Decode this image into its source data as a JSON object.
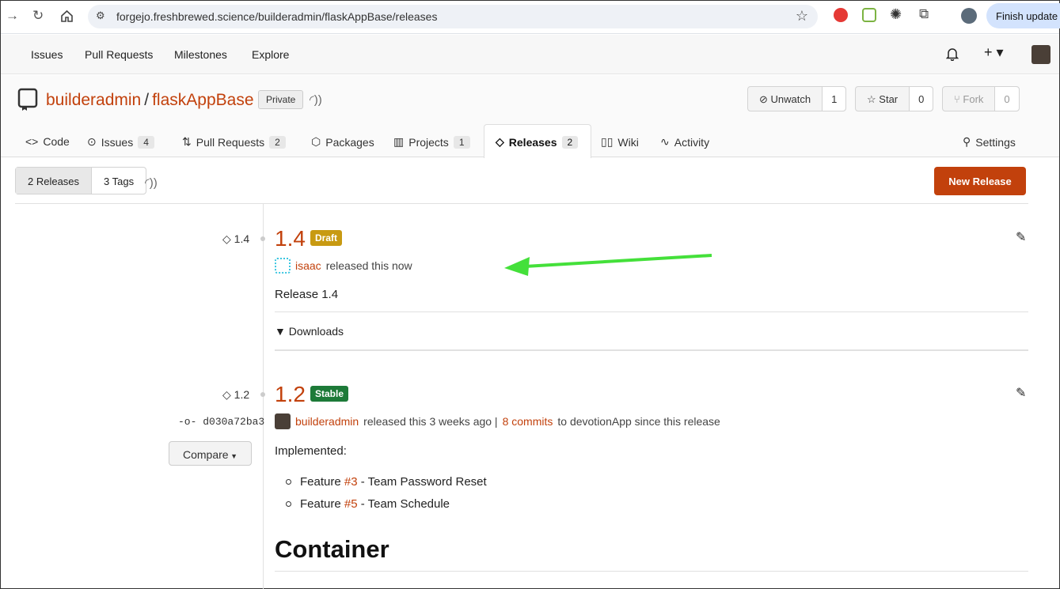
{
  "browser": {
    "url": "forgejo.freshbrewed.science/builderadmin/flaskAppBase/releases",
    "finish_update": "Finish update"
  },
  "topnav": {
    "issues": "Issues",
    "pull_requests": "Pull Requests",
    "milestones": "Milestones",
    "explore": "Explore"
  },
  "repo": {
    "owner": "builderadmin",
    "sep": "/",
    "name": "flaskAppBase",
    "visibility": "Private",
    "unwatch": {
      "label": "Unwatch",
      "count": "1"
    },
    "star": {
      "label": "Star",
      "count": "0"
    },
    "fork": {
      "label": "Fork",
      "count": "0"
    }
  },
  "tabs": {
    "code": {
      "label": "Code"
    },
    "issues": {
      "label": "Issues",
      "count": "4"
    },
    "pulls": {
      "label": "Pull Requests",
      "count": "2"
    },
    "packages": {
      "label": "Packages"
    },
    "projects": {
      "label": "Projects",
      "count": "1"
    },
    "releases": {
      "label": "Releases",
      "count": "2"
    },
    "wiki": {
      "label": "Wiki"
    },
    "activity": {
      "label": "Activity"
    },
    "settings": {
      "label": "Settings"
    }
  },
  "subnav": {
    "releases": "2 Releases",
    "tags": "3 Tags",
    "new_release": "New Release"
  },
  "releases": [
    {
      "tag": "1.4",
      "title": "1.4",
      "status": "Draft",
      "status_color": "#c89a12",
      "author": "isaac",
      "released_text": "released this now",
      "body": "Release 1.4",
      "downloads": "Downloads"
    },
    {
      "tag": "1.2",
      "commit": "d030a72ba3",
      "compare": "Compare",
      "title": "1.2",
      "status": "Stable",
      "status_color": "#1d7a38",
      "author": "builderadmin",
      "released_text": "released this 3 weeks ago |",
      "commits_link": "8 commits",
      "commits_suffix": "to devotionApp since this release",
      "implemented": "Implemented:",
      "features": [
        {
          "prefix": "Feature",
          "ref": "#3",
          "desc": "- Team Password Reset"
        },
        {
          "prefix": "Feature",
          "ref": "#5",
          "desc": "- Team Schedule"
        }
      ],
      "heading": "Container"
    }
  ],
  "colors": {
    "accent": "#c2410c",
    "annotation_arrow": "#44e03a"
  }
}
